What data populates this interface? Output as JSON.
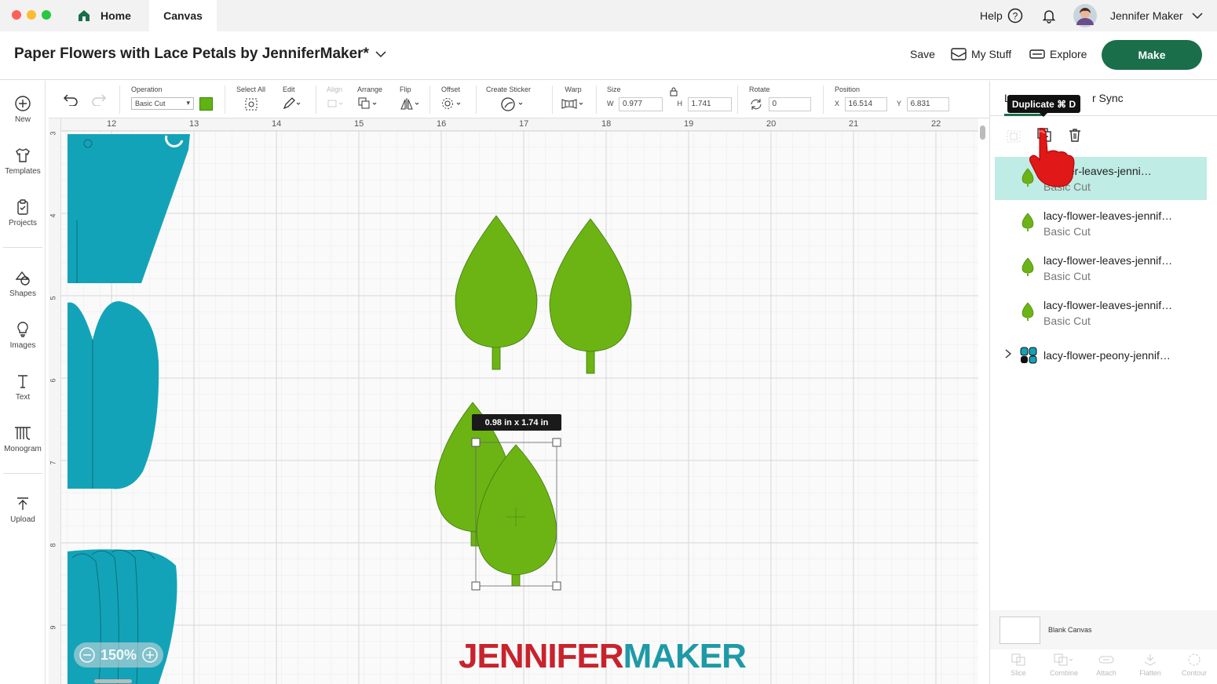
{
  "tabs": {
    "home": "Home",
    "canvas": "Canvas"
  },
  "account": {
    "help": "Help",
    "user_name": "Jennifer Maker"
  },
  "header": {
    "project_title": "Paper Flowers with Lace Petals by JenniferMaker*",
    "save": "Save",
    "my_stuff": "My Stuff",
    "explore": "Explore",
    "make": "Make"
  },
  "sidebar": {
    "items": [
      {
        "label": "New",
        "icon": "plus-circle-icon"
      },
      {
        "label": "Templates",
        "icon": "shirt-icon"
      },
      {
        "label": "Projects",
        "icon": "clipboard-icon"
      },
      {
        "label": "Shapes",
        "icon": "shapes-icon"
      },
      {
        "label": "Images",
        "icon": "lightbulb-icon"
      },
      {
        "label": "Text",
        "icon": "text-icon"
      },
      {
        "label": "Monogram",
        "icon": "monogram-icon"
      },
      {
        "label": "Upload",
        "icon": "upload-icon"
      }
    ]
  },
  "toolbar": {
    "operation_label": "Operation",
    "operation_value": "Basic Cut",
    "operation_color": "#5fb312",
    "select_all": "Select All",
    "edit": "Edit",
    "align": "Align",
    "arrange": "Arrange",
    "flip": "Flip",
    "offset": "Offset",
    "create_sticker": "Create Sticker",
    "warp": "Warp",
    "size": "Size",
    "w_label": "W",
    "w_value": "0.977",
    "h_label": "H",
    "h_value": "1.741",
    "rotate": "Rotate",
    "rotate_value": "0",
    "position": "Position",
    "x_label": "X",
    "x_value": "16.514",
    "y_label": "Y",
    "y_value": "6.831"
  },
  "canvas": {
    "ruler_x": [
      "12",
      "13",
      "14",
      "15",
      "16",
      "17",
      "18",
      "19",
      "20",
      "21",
      "22"
    ],
    "ruler_y": [
      "3",
      "4",
      "5",
      "6",
      "7",
      "8",
      "9"
    ],
    "dimension_tooltip": "0.98  in x 1.74  in",
    "zoom": "150%",
    "watermark_left": "JENNIFER",
    "watermark_right": "MAKER",
    "colors": {
      "leaf": "#6cb414",
      "petal": "#13a3b8",
      "watermark_red": "#c8232c",
      "watermark_teal": "#1e9aa6"
    }
  },
  "right_panel": {
    "tab_layers": "L",
    "tab_color_sync": "r Sync",
    "tooltip": "Duplicate ⌘ D",
    "layers": [
      {
        "name": "…ower-leaves-jenni…",
        "op": "Basic Cut",
        "selected": true
      },
      {
        "name": "lacy-flower-leaves-jennif…",
        "op": "Basic Cut",
        "selected": false
      },
      {
        "name": "lacy-flower-leaves-jennif…",
        "op": "Basic Cut",
        "selected": false
      },
      {
        "name": "lacy-flower-leaves-jennif…",
        "op": "Basic Cut",
        "selected": false
      },
      {
        "name": "lacy-flower-peony-jennif…",
        "op": "",
        "selected": false
      }
    ],
    "blank_canvas": "Blank Canvas",
    "actions": [
      "Slice",
      "Combine",
      "Attach",
      "Flatten",
      "Contour"
    ]
  }
}
